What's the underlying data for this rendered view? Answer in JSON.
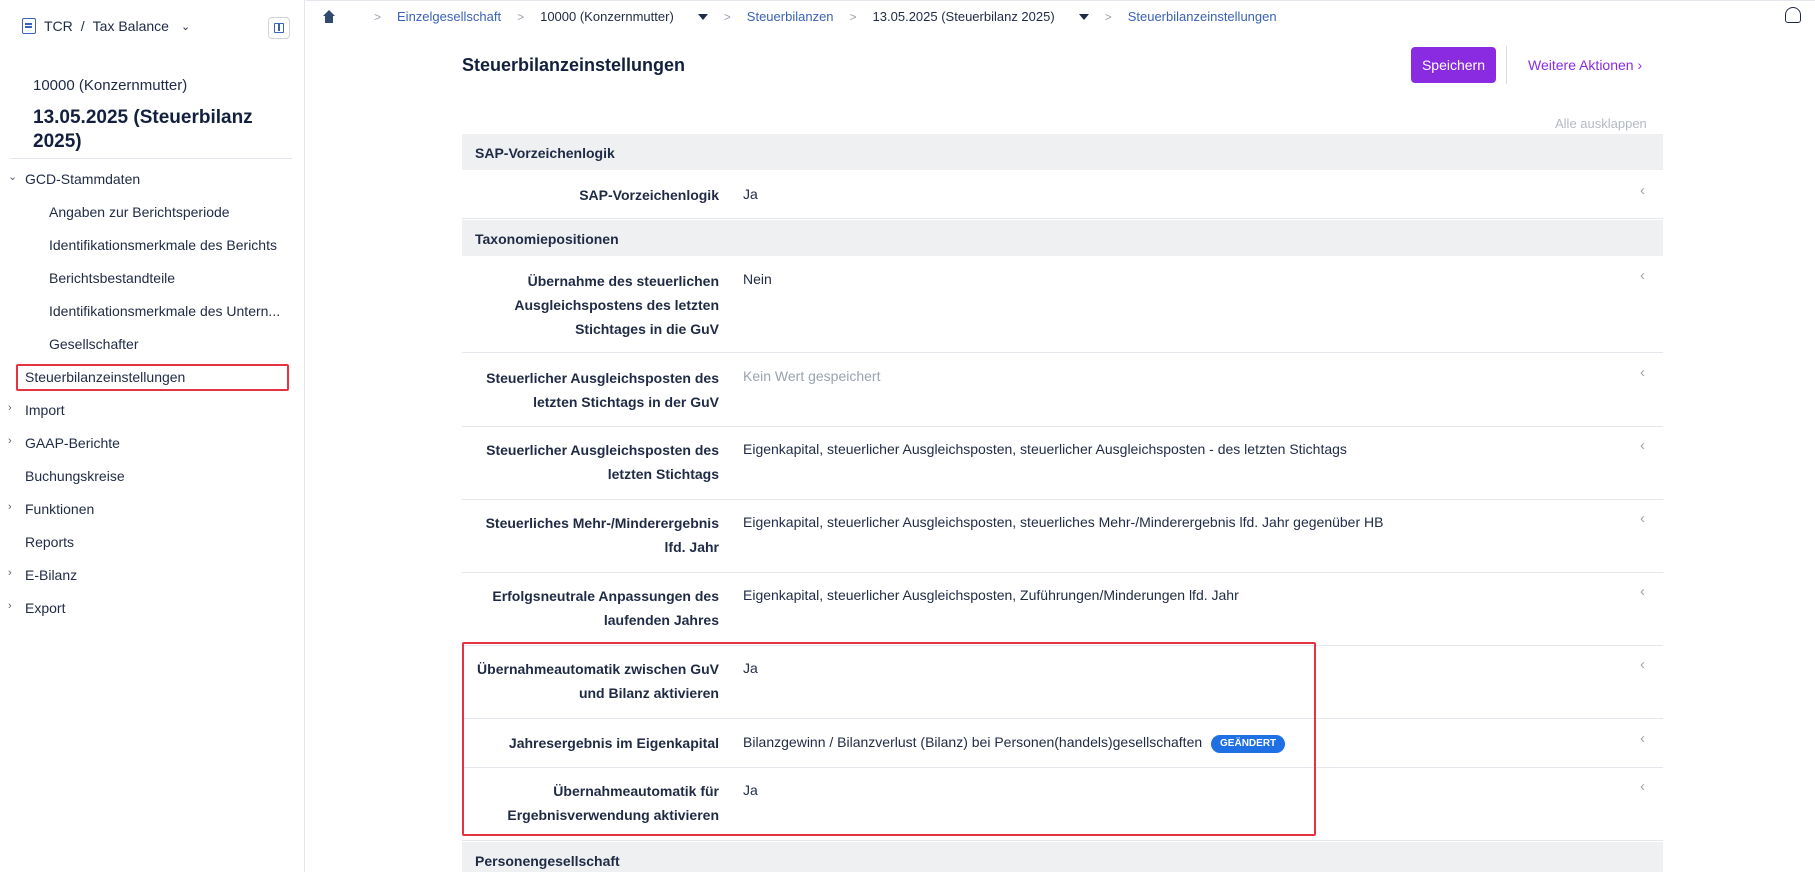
{
  "app": {
    "module": "TCR",
    "separator": "/",
    "name": "Tax Balance"
  },
  "sidebar": {
    "entity": "10000 (Konzernmutter)",
    "period": "13.05.2025 (Steuerbilanz 2025)",
    "items": [
      {
        "label": "GCD-Stammdaten",
        "caret": "⌄"
      },
      {
        "label": "Angaben zur Berichtsperiode"
      },
      {
        "label": "Identifikationsmerkmale des Berichts"
      },
      {
        "label": "Berichtsbestandteile"
      },
      {
        "label": "Identifikationsmerkmale des Untern..."
      },
      {
        "label": "Gesellschafter"
      },
      {
        "label": "Steuerbilanzeinstellungen"
      },
      {
        "label": "Import",
        "caret": "›"
      },
      {
        "label": "GAAP-Berichte",
        "caret": "›"
      },
      {
        "label": "Buchungskreise"
      },
      {
        "label": "Funktionen",
        "caret": "›"
      },
      {
        "label": "Reports"
      },
      {
        "label": "E-Bilanz",
        "caret": "›"
      },
      {
        "label": "Export",
        "caret": "›"
      }
    ]
  },
  "breadcrumb": {
    "items": [
      "Einzelgesellschaft",
      "10000 (Konzernmutter)",
      "Steuerbilanzen",
      "13.05.2025 (Steuerbilanz 2025)",
      "Steuerbilanzeinstellungen"
    ],
    "separator": ">"
  },
  "page": {
    "title": "Steuerbilanzeinstellungen",
    "save_label": "Speichern",
    "more_actions_label": "Weitere Aktionen",
    "expand_all_label": "Alle ausklappen"
  },
  "sections": {
    "sap": {
      "title": "SAP-Vorzeichenlogik",
      "rows": [
        {
          "label": "SAP-Vorzeichenlogik",
          "value": "Ja"
        }
      ]
    },
    "taxonomy": {
      "title": "Taxonomiepositionen",
      "rows": [
        {
          "label_lines": [
            "Übernahme des steuerlichen",
            "Ausgleichspostens des letzten",
            "Stichtages in die GuV"
          ],
          "value": "Nein"
        },
        {
          "label_lines": [
            "Steuerlicher Ausgleichsposten des",
            "letzten Stichtags in der GuV"
          ],
          "value": "Kein Wert gespeichert"
        },
        {
          "label_lines": [
            "Steuerlicher Ausgleichsposten des",
            "letzten Stichtags"
          ],
          "value": "Eigenkapital, steuerlicher Ausgleichsposten, steuerlicher Ausgleichsposten - des letzten Stichtags"
        },
        {
          "label_lines": [
            "Steuerliches Mehr-/Minderergebnis",
            "lfd. Jahr"
          ],
          "value": "Eigenkapital, steuerlicher Ausgleichsposten, steuerliches Mehr-/Minderergebnis lfd. Jahr gegenüber HB"
        },
        {
          "label_lines": [
            "Erfolgsneutrale Anpassungen des",
            "laufenden Jahres"
          ],
          "value": "Eigenkapital, steuerlicher Ausgleichsposten, Zuführungen/Minderungen lfd. Jahr"
        },
        {
          "label_lines": [
            "Übernahmeautomatik zwischen GuV",
            "und Bilanz aktivieren"
          ],
          "value": "Ja"
        },
        {
          "label_lines": [
            "Jahresergebnis im Eigenkapital"
          ],
          "value": "Bilanzgewinn / Bilanzverlust (Bilanz) bei Personen(handels)gesellschaften",
          "badge": "GEÄNDERT"
        },
        {
          "label_lines": [
            "Übernahmeautomatik für",
            "Ergebnisverwendung aktivieren"
          ],
          "value": "Ja"
        }
      ]
    },
    "partnership": {
      "title": "Personengesellschaft"
    }
  },
  "icons": {
    "home": "home-icon",
    "bell": "bell-icon",
    "collapse": "chevron-left-icon"
  },
  "colors": {
    "accent": "#8a2be2",
    "link": "#3a62b8",
    "badge": "#1f6fe5",
    "highlight": "#e5343f"
  }
}
